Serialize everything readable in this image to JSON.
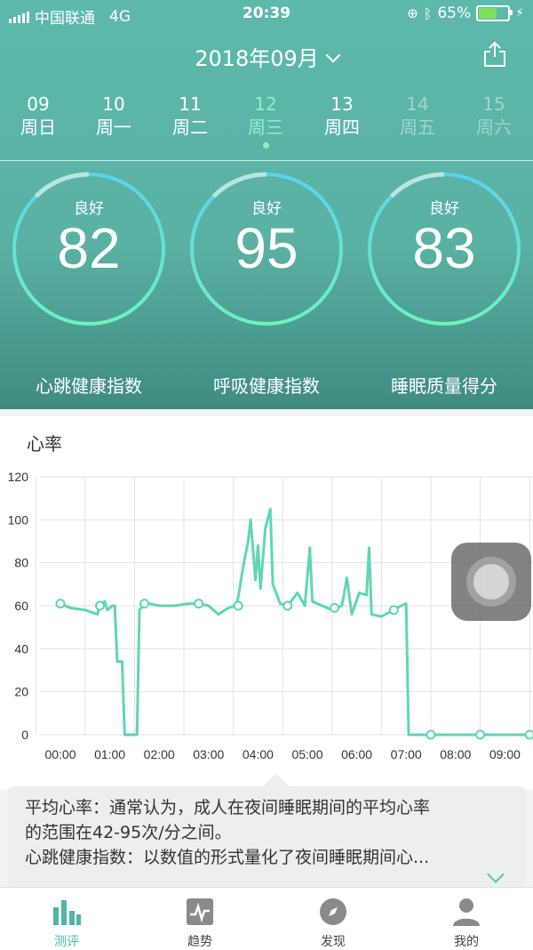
{
  "status": {
    "carrier": "中国联通",
    "network": "4G",
    "time": "20:39",
    "battery": "65%",
    "battery_level": 0.65
  },
  "header": {
    "month": "2018年09月"
  },
  "days": [
    {
      "date": "09",
      "weekday": "周日",
      "state": "normal"
    },
    {
      "date": "10",
      "weekday": "周一",
      "state": "normal"
    },
    {
      "date": "11",
      "weekday": "周二",
      "state": "normal"
    },
    {
      "date": "12",
      "weekday": "周三",
      "state": "selected"
    },
    {
      "date": "13",
      "weekday": "周四",
      "state": "normal"
    },
    {
      "date": "14",
      "weekday": "周五",
      "state": "disabled"
    },
    {
      "date": "15",
      "weekday": "周六",
      "state": "disabled"
    }
  ],
  "gauges": [
    {
      "label": "良好",
      "value": "82",
      "name": "心跳健康指数"
    },
    {
      "label": "良好",
      "value": "95",
      "name": "呼吸健康指数"
    },
    {
      "label": "良好",
      "value": "83",
      "name": "睡眠质量得分"
    }
  ],
  "section_title": "心率",
  "chart_data": {
    "type": "line",
    "title": "心率",
    "ylim": [
      0,
      120
    ],
    "y_ticks": [
      0,
      20,
      40,
      60,
      80,
      100,
      120
    ],
    "x_ticks": [
      "00:00",
      "01:00",
      "02:00",
      "03:00",
      "04:00",
      "05:00",
      "06:00",
      "07:00",
      "08:00",
      "09:00"
    ],
    "grid": true,
    "series_color": "#5fd6b6",
    "points": [
      [
        0.0,
        61
      ],
      [
        0.2,
        59
      ],
      [
        0.5,
        58
      ],
      [
        0.75,
        56
      ],
      [
        0.8,
        60
      ],
      [
        0.9,
        62
      ],
      [
        0.95,
        58
      ],
      [
        1.0,
        59
      ],
      [
        1.05,
        60
      ],
      [
        1.1,
        60
      ],
      [
        1.15,
        34
      ],
      [
        1.25,
        34
      ],
      [
        1.3,
        0
      ],
      [
        1.55,
        0
      ],
      [
        1.6,
        58
      ],
      [
        1.7,
        61
      ],
      [
        1.8,
        61
      ],
      [
        2.0,
        60
      ],
      [
        2.3,
        60
      ],
      [
        2.6,
        61
      ],
      [
        2.8,
        61
      ],
      [
        3.0,
        60
      ],
      [
        3.2,
        56
      ],
      [
        3.4,
        59
      ],
      [
        3.55,
        60
      ],
      [
        3.6,
        64
      ],
      [
        3.7,
        78
      ],
      [
        3.8,
        90
      ],
      [
        3.85,
        100
      ],
      [
        3.95,
        72
      ],
      [
        4.0,
        88
      ],
      [
        4.05,
        68
      ],
      [
        4.15,
        96
      ],
      [
        4.25,
        105
      ],
      [
        4.3,
        70
      ],
      [
        4.45,
        61
      ],
      [
        4.6,
        60
      ],
      [
        4.8,
        66
      ],
      [
        4.95,
        60
      ],
      [
        5.05,
        87
      ],
      [
        5.1,
        62
      ],
      [
        5.3,
        60
      ],
      [
        5.5,
        58
      ],
      [
        5.7,
        60
      ],
      [
        5.8,
        73
      ],
      [
        5.9,
        56
      ],
      [
        6.05,
        66
      ],
      [
        6.2,
        65
      ],
      [
        6.25,
        87
      ],
      [
        6.3,
        56
      ],
      [
        6.5,
        55
      ],
      [
        6.75,
        58
      ],
      [
        6.9,
        60
      ],
      [
        7.0,
        61
      ],
      [
        7.05,
        0
      ],
      [
        7.5,
        0
      ],
      [
        8.0,
        0
      ],
      [
        8.5,
        0
      ],
      [
        9.0,
        0
      ],
      [
        9.5,
        0
      ]
    ],
    "markers": [
      [
        0.0,
        61
      ],
      [
        0.8,
        60
      ],
      [
        1.7,
        61
      ],
      [
        2.8,
        61
      ],
      [
        3.6,
        60
      ],
      [
        4.6,
        60
      ],
      [
        5.55,
        59
      ],
      [
        6.75,
        58
      ],
      [
        7.5,
        0
      ],
      [
        8.5,
        0
      ],
      [
        9.5,
        0
      ]
    ]
  },
  "tooltip": {
    "line1": "平均心率：通常认为，成人在夜间睡眠期间的平均心率",
    "line2": "的范围在42-95次/分之间。",
    "line3": "心跳健康指数：以数值的形式量化了夜间睡眠期间心..."
  },
  "tabs": [
    {
      "label": "测评",
      "icon": "bar-chart-icon",
      "active": true
    },
    {
      "label": "趋势",
      "icon": "pulse-chart-icon",
      "active": false
    },
    {
      "label": "发现",
      "icon": "compass-icon",
      "active": false
    },
    {
      "label": "我的",
      "icon": "user-icon",
      "active": false
    }
  ]
}
